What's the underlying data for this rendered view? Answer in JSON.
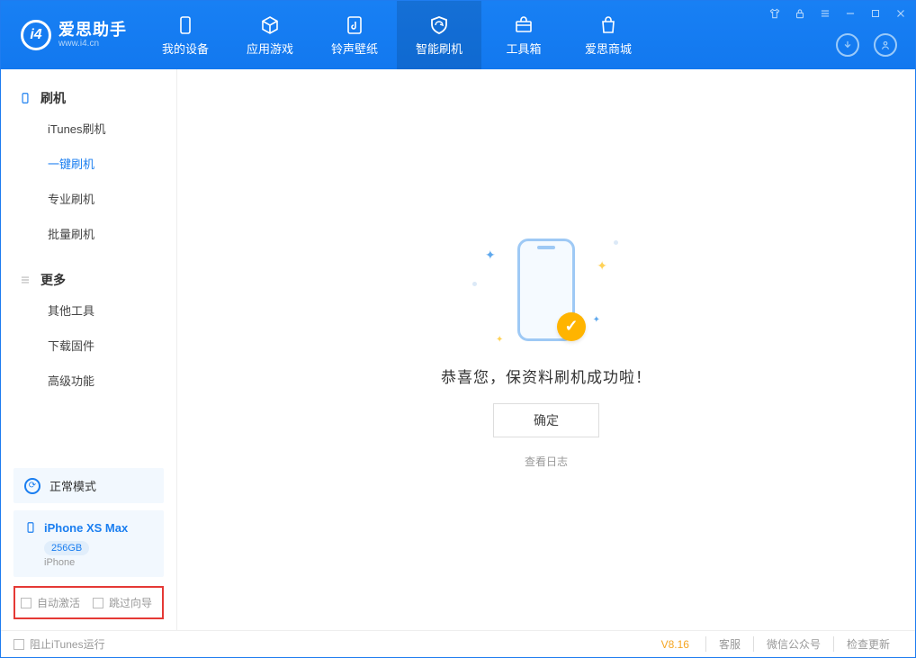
{
  "app": {
    "name_cn": "爱思助手",
    "name_en": "www.i4.cn"
  },
  "tabs": [
    {
      "label": "我的设备"
    },
    {
      "label": "应用游戏"
    },
    {
      "label": "铃声壁纸"
    },
    {
      "label": "智能刷机"
    },
    {
      "label": "工具箱"
    },
    {
      "label": "爱思商城"
    }
  ],
  "sidebar": {
    "group1": {
      "title": "刷机",
      "items": [
        "iTunes刷机",
        "一键刷机",
        "专业刷机",
        "批量刷机"
      ]
    },
    "group2": {
      "title": "更多",
      "items": [
        "其他工具",
        "下载固件",
        "高级功能"
      ]
    },
    "mode": "正常模式",
    "device": {
      "name": "iPhone XS Max",
      "capacity": "256GB",
      "type": "iPhone"
    },
    "checks": {
      "auto_activate": "自动激活",
      "skip_guide": "跳过向导"
    }
  },
  "main": {
    "success": "恭喜您，保资料刷机成功啦！",
    "ok": "确定",
    "view_log": "查看日志"
  },
  "footer": {
    "block_itunes": "阻止iTunes运行",
    "version": "V8.16",
    "links": [
      "客服",
      "微信公众号",
      "检查更新"
    ]
  }
}
